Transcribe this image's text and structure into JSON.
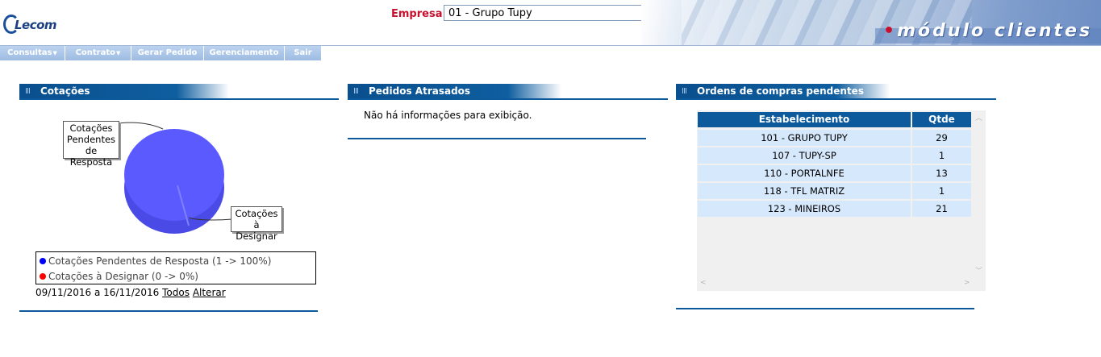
{
  "header": {
    "logo_text": "Lecom",
    "empresa_label": "Empresa:",
    "empresa_value": "01 - Grupo Tupy",
    "module_title": "módulo clientes"
  },
  "menu": {
    "items": [
      {
        "label": "Consultas",
        "has_dropdown": true
      },
      {
        "label": "Contrato",
        "has_dropdown": true
      },
      {
        "label": "Gerar Pedido",
        "has_dropdown": false
      },
      {
        "label": "Gerenciamento",
        "has_dropdown": false
      },
      {
        "label": "Sair",
        "has_dropdown": false
      }
    ]
  },
  "cotacoes": {
    "title": "Cotações",
    "callout_pendentes": [
      "Cotações",
      "Pendentes",
      "de Resposta"
    ],
    "callout_designar": [
      "Cotações",
      "à  Designar"
    ],
    "legend": [
      {
        "label": "Cotações Pendentes de Resposta (1 -> 100%)",
        "color": "#0000ff"
      },
      {
        "label": "Cotações à  Designar (0 -> 0%)",
        "color": "#ff0000"
      }
    ],
    "period": "09/11/2016 a 16/11/2016",
    "link_todos": "Todos",
    "link_alterar": "Alterar",
    "pie_color": "#5a5aff"
  },
  "pedidos": {
    "title": "Pedidos Atrasados",
    "message": "Não há informações para exibição."
  },
  "ordens": {
    "title": "Ordens de compras pendentes",
    "columns": [
      "Estabelecimento",
      "Qtde"
    ],
    "rows": [
      [
        "101 - GRUPO TUPY",
        "29"
      ],
      [
        "107 - TUPY-SP",
        "1"
      ],
      [
        "110 - PORTALNFE",
        "13"
      ],
      [
        "118 - TFL MATRIZ",
        "1"
      ],
      [
        "123 - MINEIROS",
        "21"
      ]
    ]
  },
  "colors": {
    "brand_blue": "#0c5a9c",
    "empresa_label_red": "#c8102e",
    "row_bg": "#d6e8fb"
  }
}
